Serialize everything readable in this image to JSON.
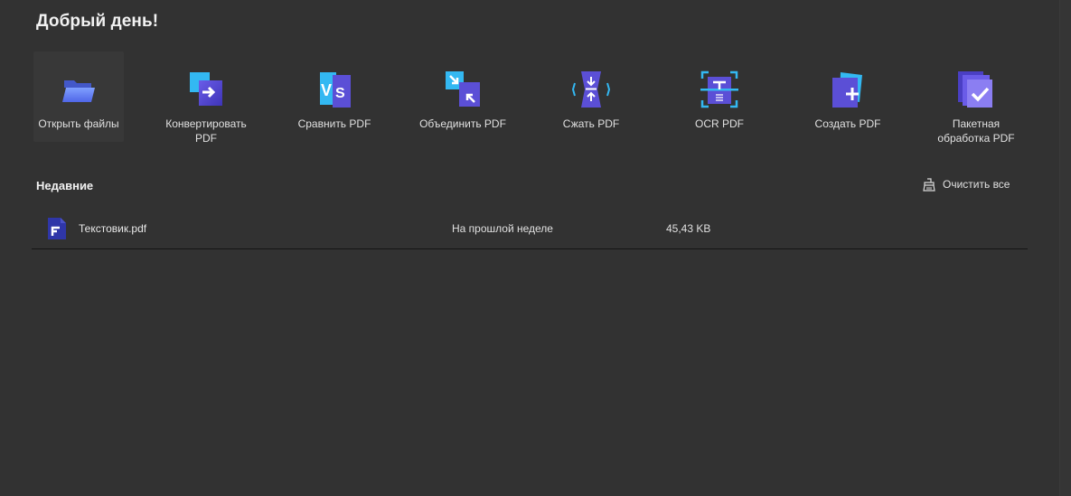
{
  "header": {
    "greeting": "Добрый день!"
  },
  "tools": [
    {
      "label": "Открыть файлы",
      "icon": "open-folder-icon"
    },
    {
      "label": "Конвертировать PDF",
      "icon": "convert-pdf-icon"
    },
    {
      "label": "Сравнить PDF",
      "icon": "compare-pdf-icon"
    },
    {
      "label": "Объединить PDF",
      "icon": "merge-pdf-icon"
    },
    {
      "label": "Сжать PDF",
      "icon": "compress-pdf-icon"
    },
    {
      "label": "OCR PDF",
      "icon": "ocr-pdf-icon"
    },
    {
      "label": "Создать PDF",
      "icon": "create-pdf-icon"
    },
    {
      "label": "Пакетная обработка PDF",
      "icon": "batch-pdf-icon"
    }
  ],
  "recent": {
    "title": "Недавние",
    "clear_label": "Очистить все",
    "clear_icon": "broom-icon",
    "files": [
      {
        "name": "Текстовик.pdf",
        "modified": "На прошлой неделе",
        "size": "45,43 KB",
        "icon": "pdf-file-icon"
      }
    ]
  },
  "colors": {
    "background": "#323232",
    "accent_purple": "#5b4fd6",
    "accent_cyan": "#2bb6f0",
    "file_icon": "#2f36a8"
  }
}
